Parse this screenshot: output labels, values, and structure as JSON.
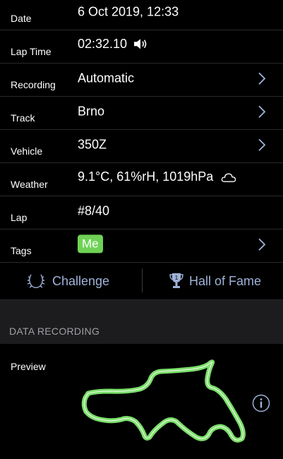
{
  "rows": {
    "date": {
      "label": "Date",
      "value": "6 Oct 2019, 12:33"
    },
    "lap_time": {
      "label": "Lap Time",
      "value": "02:32.10",
      "icon": "speaker-icon"
    },
    "recording": {
      "label": "Recording",
      "value": "Automatic"
    },
    "track": {
      "label": "Track",
      "value": "Brno"
    },
    "vehicle": {
      "label": "Vehicle",
      "value": "350Z"
    },
    "weather": {
      "label": "Weather",
      "value": "9.1°C, 61%rH, 1019hPa",
      "icon": "cloud-icon"
    },
    "lap": {
      "label": "Lap",
      "value": "#8/40"
    },
    "tags": {
      "label": "Tags",
      "tag": "Me",
      "tag_color": "#6fd256"
    }
  },
  "actions": {
    "challenge": {
      "label": "Challenge",
      "icon": "laurel-icon"
    },
    "hall_of_fame": {
      "label": "Hall of Fame",
      "icon": "trophy-icon"
    }
  },
  "section": {
    "title": "DATA RECORDING"
  },
  "preview": {
    "label": "Preview",
    "track_color": "#7be06a"
  },
  "colors": {
    "accent": "#9fb2d8",
    "background": "#000000",
    "section_bg": "#1c1c1e"
  }
}
